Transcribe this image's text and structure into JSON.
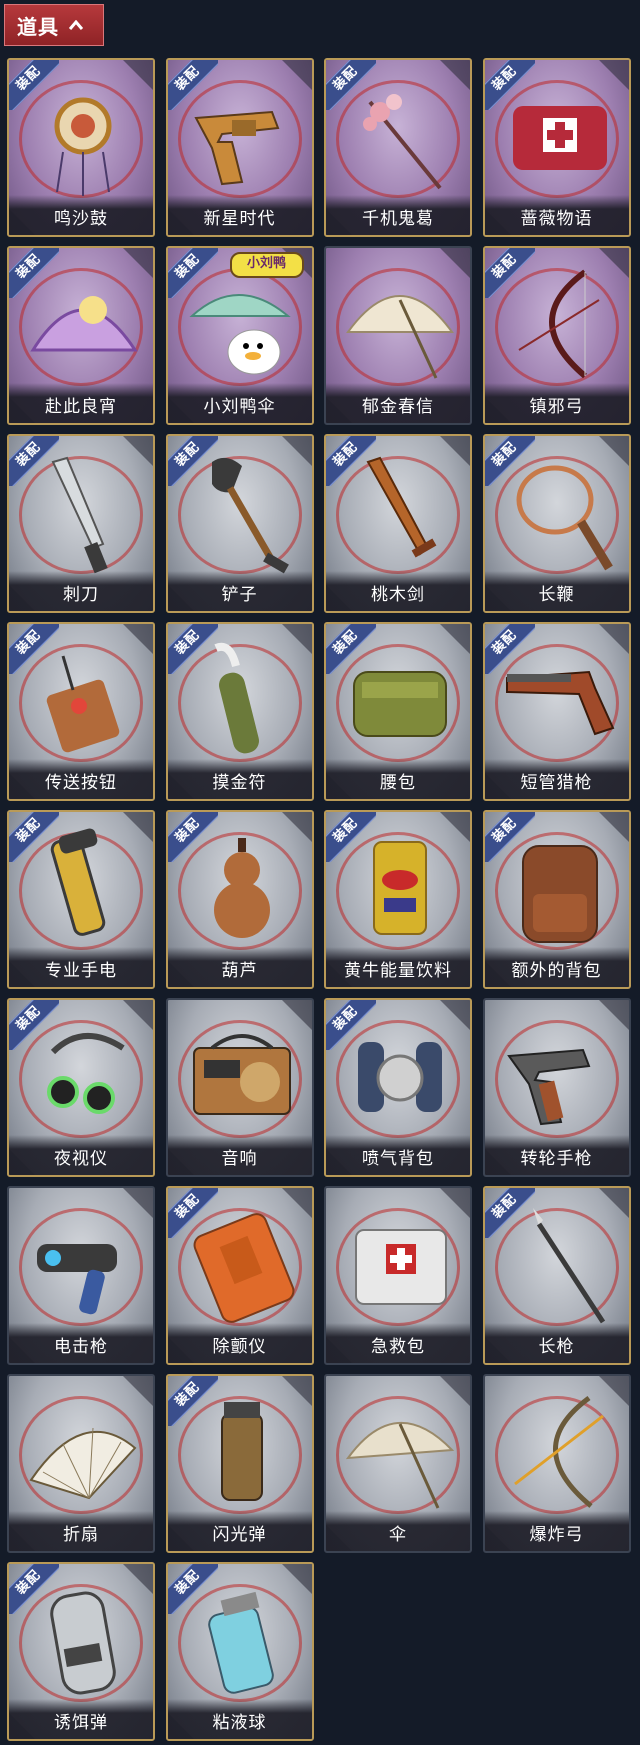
{
  "header": {
    "title": "道具",
    "toggle_icon": "chevron-up-icon"
  },
  "equip_badge": "装配",
  "collab_badge": "小刘鸭",
  "items": [
    {
      "label": "鸣沙鼓",
      "theme": "purple",
      "equipped": true,
      "icon": "drum-charm-icon"
    },
    {
      "label": "新星时代",
      "theme": "purple",
      "equipped": true,
      "icon": "revolver-icon"
    },
    {
      "label": "千机鬼葛",
      "theme": "purple",
      "equipped": true,
      "icon": "flower-staff-icon"
    },
    {
      "label": "蔷薇物语",
      "theme": "purple",
      "equipped": true,
      "icon": "medkit-icon"
    },
    {
      "label": "赴此良宵",
      "theme": "purple",
      "equipped": true,
      "icon": "moon-fan-icon"
    },
    {
      "label": "小刘鸭伞",
      "theme": "purple",
      "equipped": true,
      "icon": "duck-umbrella-icon",
      "collab": true
    },
    {
      "label": "郁金春信",
      "theme": "purple",
      "equipped": false,
      "icon": "umbrella-icon"
    },
    {
      "label": "镇邪弓",
      "theme": "purple",
      "equipped": true,
      "icon": "bow-icon"
    },
    {
      "label": "刺刀",
      "theme": "grey",
      "equipped": true,
      "icon": "bayonet-icon"
    },
    {
      "label": "铲子",
      "theme": "grey",
      "equipped": true,
      "icon": "shovel-icon"
    },
    {
      "label": "桃木剑",
      "theme": "grey",
      "equipped": true,
      "icon": "wooden-sword-icon"
    },
    {
      "label": "长鞭",
      "theme": "grey",
      "equipped": true,
      "icon": "whip-icon"
    },
    {
      "label": "传送按钮",
      "theme": "grey",
      "equipped": true,
      "icon": "remote-button-icon"
    },
    {
      "label": "摸金符",
      "theme": "grey",
      "equipped": true,
      "icon": "amulet-icon"
    },
    {
      "label": "腰包",
      "theme": "grey",
      "equipped": true,
      "icon": "waist-bag-icon"
    },
    {
      "label": "短管猎枪",
      "theme": "grey",
      "equipped": true,
      "icon": "shotgun-icon"
    },
    {
      "label": "专业手电",
      "theme": "grey",
      "equipped": true,
      "icon": "flashlight-icon"
    },
    {
      "label": "葫芦",
      "theme": "grey",
      "equipped": true,
      "icon": "gourd-icon"
    },
    {
      "label": "黄牛能量饮料",
      "theme": "grey",
      "equipped": true,
      "icon": "energy-drink-icon"
    },
    {
      "label": "额外的背包",
      "theme": "grey",
      "equipped": true,
      "icon": "backpack-icon"
    },
    {
      "label": "夜视仪",
      "theme": "grey",
      "equipped": true,
      "icon": "night-vision-icon"
    },
    {
      "label": "音响",
      "theme": "grey",
      "equipped": false,
      "icon": "radio-speaker-icon"
    },
    {
      "label": "喷气背包",
      "theme": "grey",
      "equipped": true,
      "icon": "jetpack-icon"
    },
    {
      "label": "转轮手枪",
      "theme": "grey",
      "equipped": false,
      "icon": "revolver-grey-icon"
    },
    {
      "label": "电击枪",
      "theme": "grey",
      "equipped": false,
      "icon": "taser-icon"
    },
    {
      "label": "除颤仪",
      "theme": "grey",
      "equipped": true,
      "icon": "defibrillator-icon"
    },
    {
      "label": "急救包",
      "theme": "grey",
      "equipped": false,
      "icon": "first-aid-kit-icon"
    },
    {
      "label": "长枪",
      "theme": "grey",
      "equipped": true,
      "icon": "spear-icon"
    },
    {
      "label": "折扇",
      "theme": "grey",
      "equipped": false,
      "icon": "folding-fan-icon"
    },
    {
      "label": "闪光弹",
      "theme": "grey",
      "equipped": true,
      "icon": "flashbang-icon"
    },
    {
      "label": "伞",
      "theme": "grey",
      "equipped": false,
      "icon": "parasol-icon"
    },
    {
      "label": "爆炸弓",
      "theme": "grey",
      "equipped": false,
      "icon": "explosive-bow-icon"
    },
    {
      "label": "诱饵弹",
      "theme": "grey",
      "equipped": true,
      "icon": "decoy-grenade-icon"
    },
    {
      "label": "粘液球",
      "theme": "grey",
      "equipped": true,
      "icon": "slime-ball-icon"
    }
  ]
}
